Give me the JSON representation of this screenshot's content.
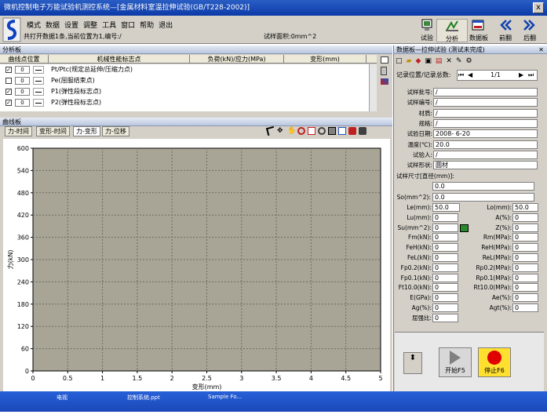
{
  "window": {
    "title": "微机控制电子万能试验机测控系统—[金属材料室温拉伸试验(GB/T228-2002)]",
    "close": "x"
  },
  "menu": [
    "模式",
    "数据",
    "设置",
    "调整",
    "工具",
    "窗口",
    "帮助",
    "退出"
  ],
  "status": {
    "open_info": "共打开数据1条,当前位置为1,编号:/",
    "area": "试样面积:0mm^2"
  },
  "toolbar": {
    "test": "试验",
    "analysis": "分析",
    "data_panel": "数据板",
    "prev": "前翻",
    "next": "后翻"
  },
  "analysis_panel": {
    "title": "分析板",
    "columns": [
      "曲线点位置",
      "机械性能标志点",
      "负荷(kN)/应力(MPa)",
      "变形(mm)"
    ],
    "rows": [
      {
        "checked": true,
        "pos": "0",
        "label": "Pt/Ptc(规定总延伸/压缩力点)"
      },
      {
        "checked": false,
        "pos": "0",
        "label": "Pe(屈服结束点)"
      },
      {
        "checked": true,
        "pos": "0",
        "label": "P1(弹性段标志点)"
      },
      {
        "checked": true,
        "pos": "0",
        "label": "P2(弹性段标志点)"
      }
    ]
  },
  "curve_panel": {
    "title": "曲线板",
    "tabs": [
      "力-时间",
      "变形-时间",
      "力-变形",
      "力-位移"
    ]
  },
  "chart_data": {
    "type": "line",
    "xlabel": "变形(mm)",
    "ylabel": "力(kN)",
    "xlim": [
      0,
      5
    ],
    "ylim": [
      0,
      600
    ],
    "x_ticks": [
      "0",
      "0.5",
      "1",
      "1.5",
      "2",
      "2.5",
      "3",
      "3.5",
      "4",
      "4.5",
      "5"
    ],
    "y_ticks": [
      "0",
      "60",
      "120",
      "180",
      "240",
      "300",
      "360",
      "420",
      "480",
      "540",
      "600"
    ],
    "grid": true,
    "plot_background": "#a8a596",
    "series": []
  },
  "data_panel": {
    "title": "数据板—拉伸试验 (测试未完成)",
    "record_label": "记录位置/记录总数:",
    "record_value": "1/1",
    "fields": [
      {
        "label": "试样批号:",
        "value": "/"
      },
      {
        "label": "试样编号:",
        "value": "/"
      },
      {
        "label": "材质:",
        "value": "/"
      },
      {
        "label": "规格:",
        "value": "/"
      },
      {
        "label": "试验日期:",
        "value": "2008- 6-20"
      },
      {
        "label": "温度(℃):",
        "value": "20.0"
      },
      {
        "label": "试验人:",
        "value": "/"
      },
      {
        "label": "试样形状:",
        "value": "圆材"
      }
    ],
    "size_label": "试样尺寸[直径(mm)]:",
    "size_value": "0.0",
    "so_label": "So(mm^2):",
    "so_value": "0.0",
    "left_fields": [
      {
        "label": "Le(mm):",
        "value": "50.0"
      },
      {
        "label": "Lu(mm):",
        "value": "0"
      },
      {
        "label": "Su(mm^2):",
        "value": "0"
      },
      {
        "label": "Fm(kN):",
        "value": "0"
      },
      {
        "label": "FeH(kN):",
        "value": "0"
      },
      {
        "label": "FeL(kN):",
        "value": "0"
      },
      {
        "label": "Fp0.2(kN):",
        "value": "0"
      },
      {
        "label": "Fp0.1(kN):",
        "value": "0"
      },
      {
        "label": "Ft10.0(kN):",
        "value": "0"
      },
      {
        "label": "E(GPa):",
        "value": "0"
      },
      {
        "label": "Ag(%):",
        "value": "0"
      },
      {
        "label": "屈强比:",
        "value": "0"
      }
    ],
    "right_fields": [
      {
        "label": "Lo(mm):",
        "value": "50.0"
      },
      {
        "label": "A(%):",
        "value": "0"
      },
      {
        "label": "Z(%):",
        "value": "0"
      },
      {
        "label": "Rm(MPa):",
        "value": "0"
      },
      {
        "label": "ReH(MPa):",
        "value": "0"
      },
      {
        "label": "ReL(MPa):",
        "value": "0"
      },
      {
        "label": "Rp0.2(MPa):",
        "value": "0"
      },
      {
        "label": "Rp0.1(MPa):",
        "value": "0"
      },
      {
        "label": "Rt10.0(MPa):",
        "value": "0"
      },
      {
        "label": "Ae(%):",
        "value": "0"
      },
      {
        "label": "Agt(%):",
        "value": "0"
      }
    ]
  },
  "controls": {
    "start": "开始F5",
    "stop": "停止F6"
  },
  "taskbar": [
    "电视",
    "控制系统.ppt",
    "Sample Fo..."
  ],
  "colors": {
    "titlebar": "#0c3aa8",
    "plot_bg": "#a8a596",
    "stop": "#e00000",
    "stop_bg": "#ffe030"
  }
}
